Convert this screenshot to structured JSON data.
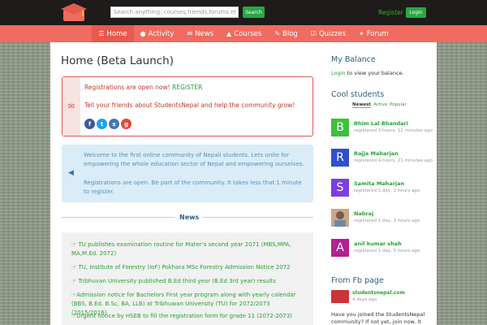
{
  "header": {
    "search_placeholder": "Search anything; courses,friends,forums etc",
    "search_button": "Search",
    "register_link": "Register",
    "login_button": "Login"
  },
  "nav": {
    "items": [
      {
        "label": "Home",
        "icon": "home-icon"
      },
      {
        "label": "Activity",
        "icon": "users-icon"
      },
      {
        "label": "News",
        "icon": "envelope-icon"
      },
      {
        "label": "Courses",
        "icon": "graduation-cap-icon"
      },
      {
        "label": "Blog",
        "icon": "rss-icon"
      },
      {
        "label": "Quizzes",
        "icon": "check-square-icon"
      },
      {
        "label": "Forum",
        "icon": "comments-icon"
      }
    ]
  },
  "main": {
    "title": "Home (Beta Launch)",
    "alert": {
      "line1_prefix": "Registrations are open now!",
      "line1_link": "REGISTER",
      "line2": "Tell your friends about StudentsNepal and help the community grow!"
    },
    "info": {
      "p1": "Welcome to the first online community of Nepali students. Lets unite for empowering the whole education sector of Nepal and empowering ourselves.",
      "p2": "Registrations are open. Be part of the community. It takes less that 1 minute to register."
    },
    "news_title": "News",
    "news": [
      "☞ TU publishes examination routine for Mater’s second year 2071 (MBS,MPA, MA,M.Ed. 2072)",
      "☞ TU, Institute of Forestry (IoF) Pokhara MSc Forestry Admission Notice 2072",
      "☞ Tribhuvan University published B.Ed third year (B.Ed 3rd year) results",
      "☞Admission notice for Bachelors First year program along with yearly calendar (BBS, B.Ed. B.Sc, BA, LLB) at Tribhuwan University (TU) for 2072/2073 (2015/2016)",
      "☞Urgent notice by HSEB to fill the registration form for grade 11 (2072-2073)"
    ]
  },
  "sidebar": {
    "balance_title": "My Balance",
    "balance_link": "Login",
    "balance_text": "to view your balance.",
    "students_title": "Cool students",
    "tabs": [
      "Newest",
      "Active",
      "Popular"
    ],
    "students": [
      {
        "initial": "B",
        "name": "Bhim Lal Bhandari",
        "meta": "registered 3 hours, 12 minutes ago",
        "color": "#3cc13c"
      },
      {
        "initial": "R",
        "name": "Rajja Maharjan",
        "meta": "registered 4 hours, 21 minutes ago",
        "color": "#2f4fd1"
      },
      {
        "initial": "S",
        "name": "Samita Maharjan",
        "meta": "registered 1 day, 2 hours ago",
        "color": "#7b3fe0"
      },
      {
        "initial": "",
        "name": "Nabraj",
        "meta": "registered 1 day, 3 hours ago",
        "color": "#c9a78a"
      },
      {
        "initial": "A",
        "name": "anil kumar shah",
        "meta": "registered 1 day, 5 hours ago",
        "color": "#b0228f"
      }
    ],
    "fb_title": "From Fb page",
    "fb_name": "studentsnepal.com",
    "fb_date": "4 days ago",
    "fb_text": "Have you joined the StudentsNepal community? If not yet, join now. It takes"
  }
}
